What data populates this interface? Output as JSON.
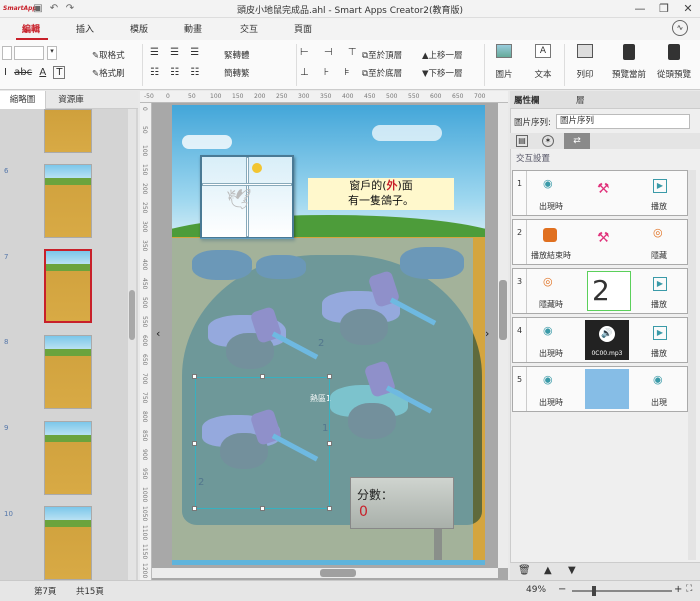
{
  "app": {
    "logo_text": "SmartApps",
    "title": "頭皮小地鼠完成品.ahl - Smart Apps Creator2(教育版)"
  },
  "window_controls": {
    "minimize": "—",
    "restore": "❐",
    "close": "✕"
  },
  "ribbon_tabs": [
    "編輯",
    "插入",
    "模版",
    "動畫",
    "交互",
    "頁面"
  ],
  "ribbon": {
    "clear_format": "取格式",
    "format_brush": "格式刷",
    "font_bold": "B",
    "font_italic": "I",
    "font_underline": "U",
    "font_abc": "abc",
    "font_color": "A",
    "text_T": "T",
    "vertical_align": "緊轉體",
    "simplify": "簡轉繁",
    "to_top": "至於頂層",
    "to_bottom": "至於底層",
    "move_up": "上移一層",
    "move_down": "下移一層",
    "picture": "圖片",
    "text": "文本",
    "print": "列印",
    "preview_current": "預覽當前",
    "preview_from_start": "從頭預覽"
  },
  "left_panel": {
    "tabs": [
      "縮略圖",
      "資源庫"
    ],
    "page_numbers": [
      "6",
      "7",
      "8",
      "9",
      "10"
    ]
  },
  "ruler": {
    "top": [
      "-50",
      "0",
      "50",
      "100",
      "150",
      "200",
      "250",
      "300",
      "350",
      "400",
      "450",
      "500",
      "550",
      "600",
      "650",
      "700"
    ],
    "left": [
      "0",
      "50",
      "100",
      "150",
      "200",
      "250",
      "300",
      "350",
      "400",
      "450",
      "500",
      "550",
      "600",
      "650",
      "700",
      "750",
      "800",
      "850",
      "900",
      "950",
      "1000",
      "1050",
      "1100",
      "1150",
      "1200"
    ]
  },
  "canvas": {
    "caption_line1a": "窗戶的",
    "caption_paren_open": "(",
    "caption_highlight": "外",
    "caption_paren_close": ")",
    "caption_line1b": "面",
    "caption_line2": "有一隻鴿子。",
    "score_label": "分數：",
    "score_value": "0",
    "hit_label": "熱區1",
    "mole_numbers": [
      "2",
      "2",
      "1"
    ],
    "prev_arrow": "‹",
    "next_arrow": "›"
  },
  "right_panel": {
    "tabs": [
      "屬性欄",
      "層"
    ],
    "image_seq_label": "圖片序列:",
    "image_seq_value": "圖片序列",
    "interaction_header": "交互設置",
    "rows": [
      {
        "num": "1",
        "trigger": "出現時",
        "action": "播放"
      },
      {
        "num": "2",
        "trigger": "播放結束時",
        "action": "隱藏"
      },
      {
        "num": "3",
        "trigger": "隱藏時",
        "action": "播放",
        "thumb_text": "2"
      },
      {
        "num": "4",
        "trigger": "出現時",
        "action": "播放",
        "thumb_text": "0C00.mp3"
      },
      {
        "num": "5",
        "trigger": "出現時",
        "action": "出現"
      }
    ]
  },
  "status": {
    "page_info": "第7頁",
    "total_pages": "共15頁",
    "zoom": "49%"
  },
  "colors": {
    "accent": "#c8202a",
    "eye_icon": "#3a9aa8",
    "orange_icon": "#e07020"
  }
}
